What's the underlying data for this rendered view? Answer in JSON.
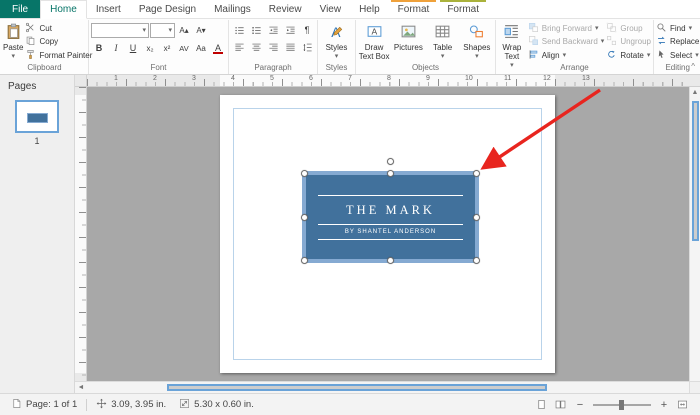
{
  "colors": {
    "accent": "#077568",
    "textbox_fill": "#41719C",
    "textbox_border": "#85AAD2",
    "arrow": "#E8251F",
    "canvas_bg": "#A8A8A8"
  },
  "glyphs": {
    "dropdown": "▾",
    "scroll_up": "▲",
    "scroll_down": "▼",
    "scroll_left": "◄",
    "scroll_right": "►",
    "zoom_out": "−",
    "zoom_in": "+",
    "collapse": "^",
    "pilcrow": "¶"
  },
  "tabs": [
    {
      "label": "File"
    },
    {
      "label": "Home"
    },
    {
      "label": "Insert"
    },
    {
      "label": "Page Design"
    },
    {
      "label": "Mailings"
    },
    {
      "label": "Review"
    },
    {
      "label": "View"
    },
    {
      "label": "Help"
    },
    {
      "label": "Format"
    },
    {
      "label": "Format"
    }
  ],
  "ribbon": {
    "clipboard": {
      "label": "Clipboard",
      "paste": "Paste",
      "cut": "Cut",
      "copy": "Copy",
      "format_painter": "Format Painter"
    },
    "font": {
      "label": "Font",
      "name_value": "",
      "size_value": "",
      "grow": "A▴",
      "shrink": "A▾",
      "bold": "B",
      "italic": "I",
      "underline": "U",
      "subscript": "x₂",
      "superscript": "x²",
      "spacing": "AV",
      "case_btn": "Aa",
      "color": "A"
    },
    "paragraph": {
      "label": "Paragraph"
    },
    "styles": {
      "label": "Styles",
      "styles": "Styles"
    },
    "objects": {
      "label": "Objects",
      "draw_text_box": "Draw Text Box",
      "pictures": "Pictures",
      "table": "Table",
      "shapes": "Shapes"
    },
    "arrange": {
      "label": "Arrange",
      "wrap_text": "Wrap Text",
      "bring_forward": "Bring Forward",
      "send_backward": "Send Backward",
      "align": "Align",
      "group": "Group",
      "ungroup": "Ungroup",
      "rotate": "Rotate"
    },
    "editing": {
      "label": "Editing",
      "find": "Find",
      "replace": "Replace",
      "select": "Select"
    }
  },
  "pages_panel": {
    "title": "Pages",
    "page_label": "1"
  },
  "document": {
    "textbox": {
      "title": "THE MARK",
      "byline": "BY SHANTEL ANDERSON"
    }
  },
  "ruler": {
    "h": [
      "1",
      "2",
      "3",
      "4",
      "5",
      "6",
      "7",
      "8",
      "9",
      "10",
      "11",
      "12",
      "13"
    ]
  },
  "status_bar": {
    "page_info": "Page: 1 of 1",
    "position": "3.09, 3.95 in.",
    "size": "5.30 x 0.60 in."
  }
}
